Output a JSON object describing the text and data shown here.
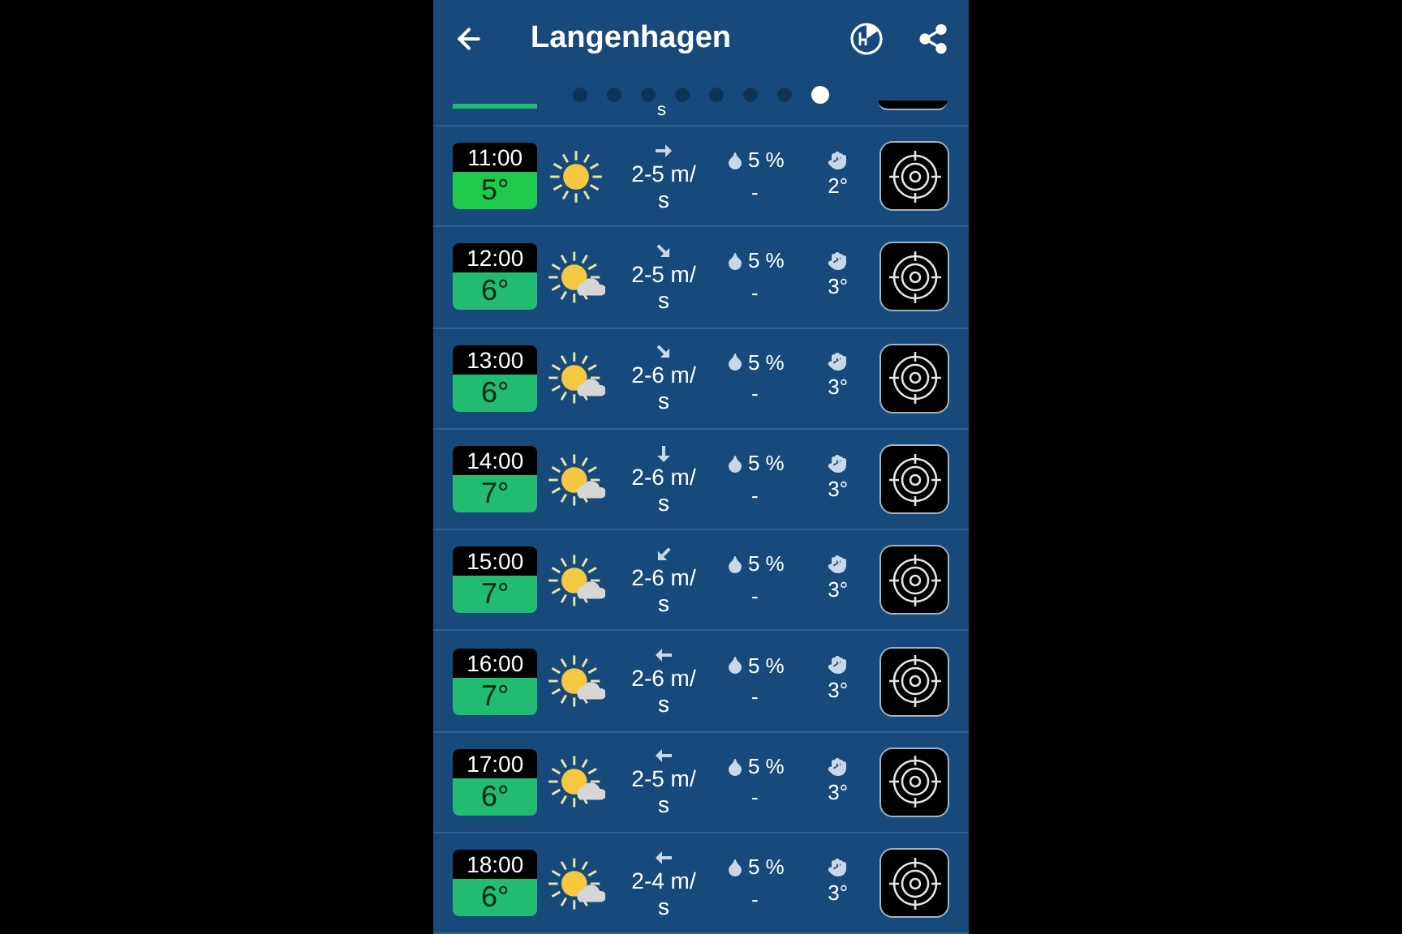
{
  "header": {
    "title": "Langenhagen"
  },
  "pager": [
    {
      "selected": false
    },
    {
      "selected": false
    },
    {
      "selected": false
    },
    {
      "selected": false
    },
    {
      "selected": false
    },
    {
      "selected": false
    },
    {
      "selected": false
    },
    {
      "selected": true
    }
  ],
  "partial_row": {
    "wind_tail": "s"
  },
  "rows": [
    {
      "time": "11:00",
      "temp": "5°",
      "color": "#1ec94c",
      "sky": {
        "kind": "sunny"
      },
      "wind_arrow": {
        "kind": "right"
      },
      "wind": "2-5 m/s",
      "rain": "5 %",
      "rain_amount": "-",
      "gust": "2°"
    },
    {
      "time": "12:00",
      "temp": "6°",
      "color": "#22bb74",
      "sky": {
        "kind": "cloudy"
      },
      "wind_arrow": {
        "kind": "southeast"
      },
      "wind": "2-5 m/s",
      "rain": "5 %",
      "rain_amount": "-",
      "gust": "3°"
    },
    {
      "time": "13:00",
      "temp": "6°",
      "color": "#22bb74",
      "sky": {
        "kind": "cloudy"
      },
      "wind_arrow": {
        "kind": "southeast"
      },
      "wind": "2-6 m/s",
      "rain": "5 %",
      "rain_amount": "-",
      "gust": "3°"
    },
    {
      "time": "14:00",
      "temp": "7°",
      "color": "#22bb74",
      "sky": {
        "kind": "cloudy"
      },
      "wind_arrow": {
        "kind": "down"
      },
      "wind": "2-6 m/s",
      "rain": "5 %",
      "rain_amount": "-",
      "gust": "3°"
    },
    {
      "time": "15:00",
      "temp": "7°",
      "color": "#22bb74",
      "sky": {
        "kind": "cloudy"
      },
      "wind_arrow": {
        "kind": "southwest"
      },
      "wind": "2-6 m/s",
      "rain": "5 %",
      "rain_amount": "-",
      "gust": "3°"
    },
    {
      "time": "16:00",
      "temp": "7°",
      "color": "#22bb74",
      "sky": {
        "kind": "cloudy"
      },
      "wind_arrow": {
        "kind": "left"
      },
      "wind": "2-6 m/s",
      "rain": "5 %",
      "rain_amount": "-",
      "gust": "3°"
    },
    {
      "time": "17:00",
      "temp": "6°",
      "color": "#22bb74",
      "sky": {
        "kind": "cloudy"
      },
      "wind_arrow": {
        "kind": "left"
      },
      "wind": "2-5 m/s",
      "rain": "5 %",
      "rain_amount": "-",
      "gust": "3°"
    },
    {
      "time": "18:00",
      "temp": "6°",
      "color": "#22bb74",
      "sky": {
        "kind": "cloudy"
      },
      "wind_arrow": {
        "kind": "left"
      },
      "wind": "2-4 m/s",
      "rain": "5 %",
      "rain_amount": "-",
      "gust": "3°"
    }
  ]
}
